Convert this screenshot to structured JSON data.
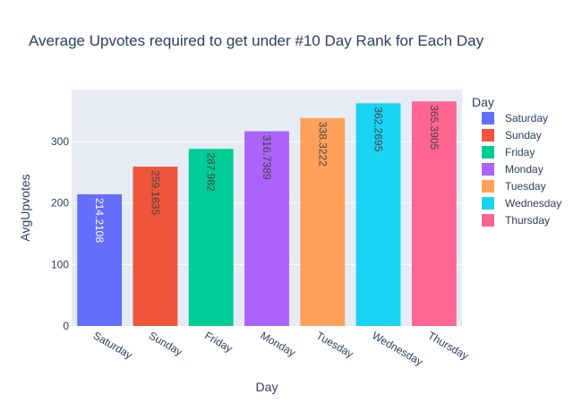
{
  "chart_data": {
    "type": "bar",
    "title": "Average Upvotes required to get under #10 Day Rank for Each Day",
    "xlabel": "Day",
    "ylabel": "AvgUpvotes",
    "categories": [
      "Saturday",
      "Sunday",
      "Friday",
      "Monday",
      "Tuesday",
      "Wednesday",
      "Thursday"
    ],
    "values": [
      214.2108,
      259.1635,
      287.982,
      316.7389,
      338.3222,
      362.2695,
      365.3905
    ],
    "value_labels": [
      "214.2108",
      "259.1635",
      "287.982",
      "316.7389",
      "338.3222",
      "362.2695",
      "365.3905"
    ],
    "colors": [
      "#636efa",
      "#EF553B",
      "#00cc96",
      "#ab63fa",
      "#FFA15A",
      "#19d3f3",
      "#FF6692"
    ],
    "label_colors": [
      "#ffffff",
      "#444444",
      "#444444",
      "#444444",
      "#444444",
      "#444444",
      "#444444"
    ],
    "yticks": [
      0,
      100,
      200,
      300
    ],
    "ylim": [
      0,
      384.6
    ],
    "grid": true,
    "plot_background": "#E5ECF6",
    "legend": {
      "title": "Day",
      "placement": "right",
      "entries": [
        "Saturday",
        "Sunday",
        "Friday",
        "Monday",
        "Tuesday",
        "Wednesday",
        "Thursday"
      ]
    }
  }
}
